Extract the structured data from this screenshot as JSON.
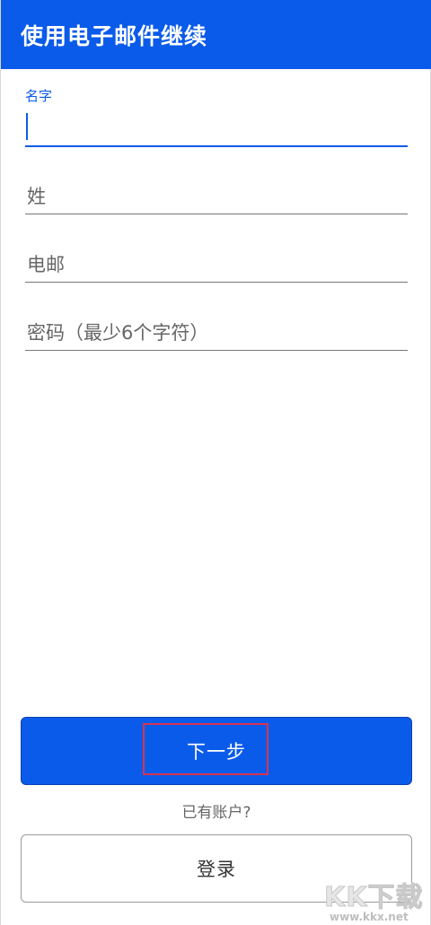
{
  "header": {
    "title": "使用电子邮件继续"
  },
  "form": {
    "first_name": {
      "label": "名字",
      "value": ""
    },
    "last_name": {
      "placeholder": "姓"
    },
    "email": {
      "placeholder": "电邮"
    },
    "password": {
      "placeholder": "密码（最少6个字符）"
    }
  },
  "actions": {
    "next_label": "下一步",
    "have_account_text": "已有账户?",
    "login_label": "登录"
  },
  "watermark": {
    "main": "KK下载",
    "url": "www.kkx.net"
  },
  "colors": {
    "accent": "#0a5bea",
    "highlight": "#d8344f"
  }
}
